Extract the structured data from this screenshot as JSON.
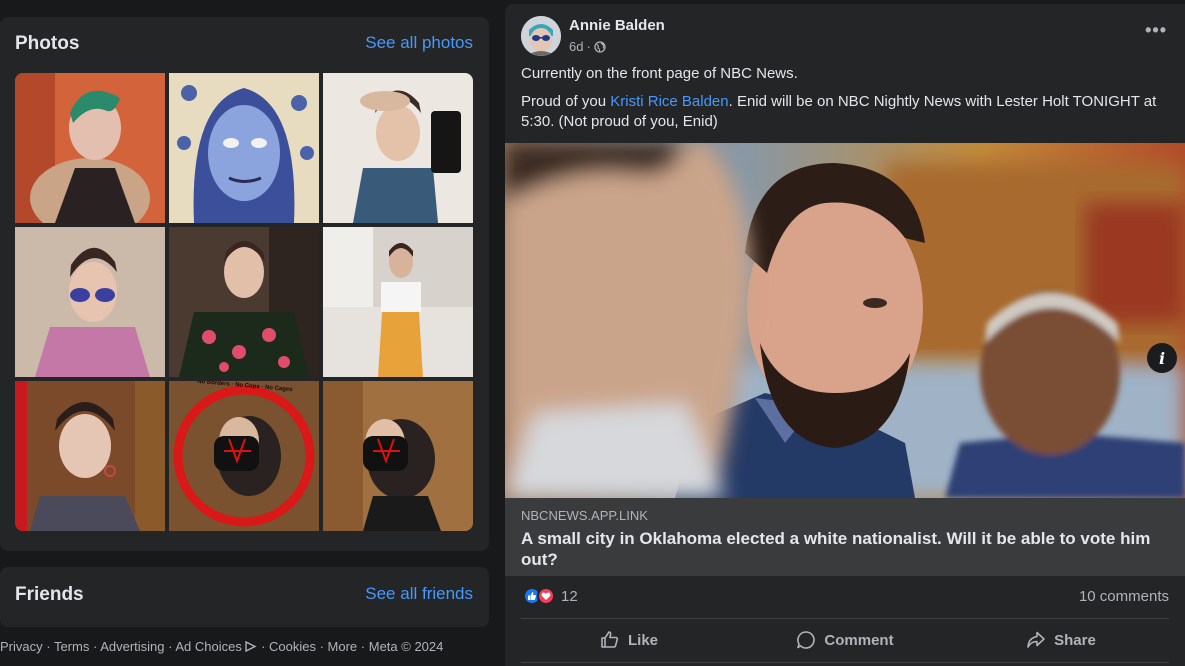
{
  "photos": {
    "title": "Photos",
    "see_all": "See all photos",
    "sign_text": "No Borders · No Cops · No Cages"
  },
  "friends": {
    "title": "Friends",
    "see_all": "See all friends"
  },
  "footer": {
    "items": [
      "Privacy",
      "Terms",
      "Advertising",
      "Ad Choices",
      "Cookies",
      "More",
      "Meta © 2024"
    ]
  },
  "post": {
    "author": "Annie Balden",
    "time": "6d",
    "privacy_icon": "globe-icon",
    "line1": "Currently on the front page of NBC News.",
    "line2_pre": "Proud of you ",
    "mention": "Kristi Rice Balden",
    "line2_post": ". Enid will be on NBC Nightly News with Lester Holt TONIGHT at 5:30. (Not proud of you, Enid)",
    "link": {
      "domain": "NBCNEWS.APP.LINK",
      "title": "A small city in Oklahoma elected a white nationalist. Will it be able to vote him out?"
    },
    "reactions_count": "12",
    "comments": "10 comments",
    "actions": {
      "like": "Like",
      "comment": "Comment",
      "share": "Share"
    }
  },
  "colors": {
    "accent": "#4599ff",
    "background": "#18191a",
    "card": "#242526",
    "link_bg": "#3a3b3c",
    "like": "#1877f2",
    "love": "#f33e58"
  }
}
